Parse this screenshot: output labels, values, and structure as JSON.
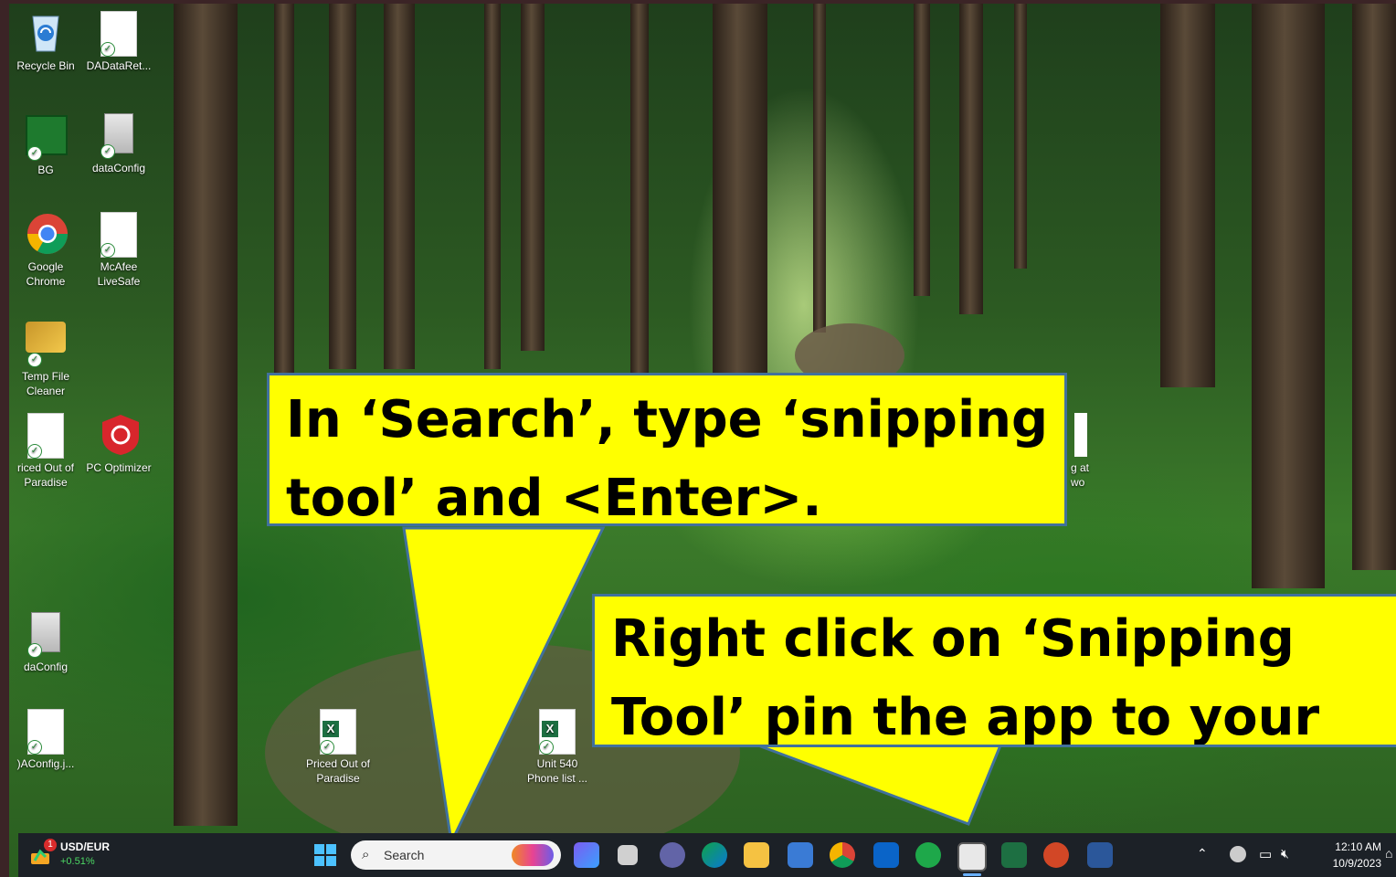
{
  "desktop_icons": [
    {
      "label": "Recycle Bin",
      "icon": "recycle-bin-icon"
    },
    {
      "label": "DADataRet...",
      "icon": "document-icon"
    },
    {
      "label": "BG",
      "icon": "image-file-icon"
    },
    {
      "label": "dataConfig",
      "icon": "config-file-icon"
    },
    {
      "label": "Google\nChrome",
      "icon": "chrome-icon"
    },
    {
      "label": "McAfee\nLiveSafe",
      "icon": "document-icon"
    },
    {
      "label": "Temp File\nCleaner",
      "icon": "cleaner-icon"
    },
    {
      "label": "riced Out of\nParadise",
      "icon": "word-doc-icon"
    },
    {
      "label": "PC Optimizer",
      "icon": "pc-optimizer-icon"
    },
    {
      "label": "daConfig",
      "icon": "config-file-icon"
    },
    {
      "label": ")AConfig.j...",
      "icon": "document-icon"
    },
    {
      "label": "Priced Out of\nParadise",
      "icon": "excel-file-icon"
    },
    {
      "label": "Unit 540\nPhone list ...",
      "icon": "excel-file-icon"
    },
    {
      "label": "g at\nwo",
      "icon": "partial-icon"
    }
  ],
  "callouts": {
    "search": "In ‘Search’, type ‘snipping tool’ and <Enter>.",
    "pin": "Right click on ‘Snipping Tool’ pin the app to your taskbar."
  },
  "taskbar": {
    "widget_title": "USD/EUR",
    "widget_value": "+0.51%",
    "widget_badge": "1",
    "search_placeholder": "Search",
    "time": "12:10 AM",
    "date": "10/9/2023",
    "accent_color": "#ffff00"
  }
}
